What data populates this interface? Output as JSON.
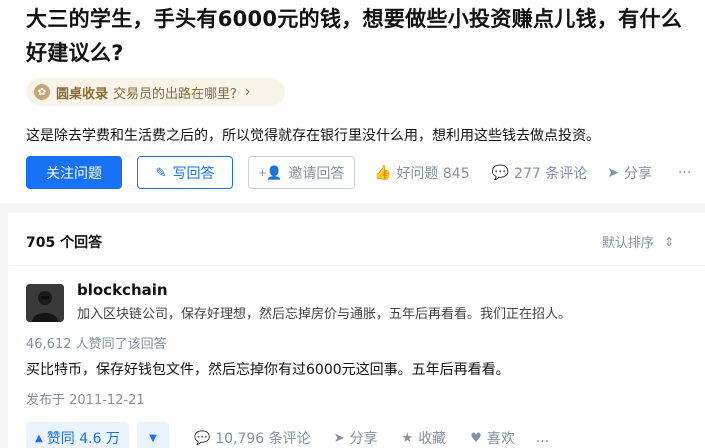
{
  "question": {
    "title": "大三的学生，手头有6000元的钱，想要做些小投资赚点儿钱，有什么好建议么?",
    "roundtable": {
      "name": "圆桌收录",
      "topic": "交易员的出路在哪里?"
    },
    "detail": "这是除去学费和生活费之后的，所以觉得就存在银行里没什么用，想利用这些钱去做点投资。",
    "buttons": {
      "follow": "关注问题",
      "write": "写回答",
      "invite": "邀请回答"
    },
    "stats": {
      "good_question": "好问题 845",
      "comments": "277 条评论",
      "share": "分享"
    }
  },
  "answers": {
    "count_label": "705 个回答",
    "sort_label": "默认排序",
    "first": {
      "author_name": "blockchain",
      "author_bio": "加入区块链公司，保存好理想，然后忘掉房价与通胀，五年后再看看。我们正在招人。",
      "votes_line": "46,612 人赞同了该回答",
      "content": "买比特币，保存好钱包文件，然后忘掉你有过6000元这回事。五年后再看看。",
      "published": "发布于 2011-12-21",
      "actions": {
        "upvote": "赞同 4.6 万",
        "comments": "10,796 条评论",
        "share": "分享",
        "collect": "收藏",
        "like": "喜欢",
        "more": "..."
      }
    }
  },
  "colors": {
    "accent": "#1772f6",
    "muted": "#8590a6",
    "roundtable": "#8c6d35"
  }
}
